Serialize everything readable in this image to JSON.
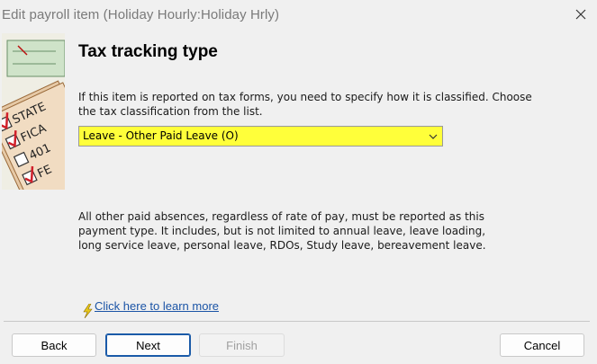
{
  "window": {
    "title": "Edit payroll item (Holiday Hourly:Holiday Hrly)"
  },
  "page": {
    "heading": "Tax tracking type",
    "instructions": "If this item is reported on tax forms, you need to specify how it is classified. Choose the tax classification from the list.",
    "tax_select": {
      "value": "Leave - Other Paid Leave (O)",
      "highlight_color": "#ffff3a"
    },
    "description": "All other paid absences, regardless of rate of pay, must be reported as this payment type. It includes, but is not limited to annual leave, leave loading, long service leave, personal leave, RDOs, Study leave, bereavement leave.",
    "learn_more": "Click here to learn more"
  },
  "side_image": {
    "icon": "tax-forms-checklist-icon",
    "labels": [
      "STATE",
      "FICA",
      "401",
      "FE"
    ]
  },
  "footer": {
    "back": "Back",
    "next": "Next",
    "finish": "Finish",
    "cancel": "Cancel"
  },
  "colors": {
    "link": "#1b54a6",
    "primary_border": "#1a5aa8",
    "checkmark": "#d0202a"
  }
}
